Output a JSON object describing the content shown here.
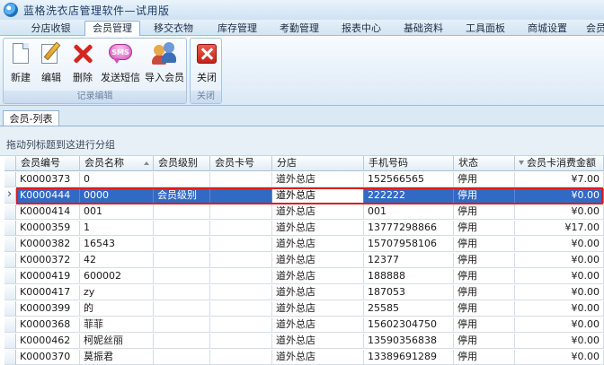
{
  "window": {
    "title": "蓝格洗衣店管理软件—试用版"
  },
  "menu": {
    "tabs": [
      {
        "label": "分店收银",
        "active": false
      },
      {
        "label": "会员管理",
        "active": true
      },
      {
        "label": "移交衣物",
        "active": false
      },
      {
        "label": "库存管理",
        "active": false
      },
      {
        "label": "考勤管理",
        "active": false
      },
      {
        "label": "报表中心",
        "active": false
      },
      {
        "label": "基础资料",
        "active": false
      },
      {
        "label": "工具面板",
        "active": false
      },
      {
        "label": "商城设置",
        "active": false
      },
      {
        "label": "会员",
        "active": false
      }
    ]
  },
  "ribbon": {
    "groups": [
      {
        "label": "记录编辑",
        "buttons": [
          {
            "label": "新建",
            "icon": "new-document-icon"
          },
          {
            "label": "编辑",
            "icon": "edit-pen-icon"
          },
          {
            "label": "删除",
            "icon": "delete-x-icon"
          },
          {
            "label": "发送短信",
            "icon": "sms-bubble-icon"
          },
          {
            "label": "导入会员",
            "icon": "import-members-icon"
          }
        ]
      },
      {
        "label": "关闭",
        "buttons": [
          {
            "label": "关闭",
            "icon": "close-red-icon"
          }
        ]
      }
    ]
  },
  "document_tab": {
    "label": "会员-列表"
  },
  "grid": {
    "group_hint": "拖动列标题到这进行分组",
    "columns": [
      "会员编号",
      "会员名称",
      "会员级别",
      "会员卡号",
      "分店",
      "手机号码",
      "状态",
      "会员卡消费金额"
    ],
    "selected_row": 1,
    "rows": [
      [
        "K0000373",
        "0",
        "",
        "",
        "道外总店",
        "152566565",
        "停用",
        "¥7.00"
      ],
      [
        "K0000444",
        "0000",
        "会员级别",
        "",
        "道外总店",
        "222222",
        "停用",
        "¥0.00"
      ],
      [
        "K0000414",
        "001",
        "",
        "",
        "道外总店",
        "001",
        "停用",
        "¥0.00"
      ],
      [
        "K0000359",
        "1",
        "",
        "",
        "道外总店",
        "13777298866",
        "停用",
        "¥17.00"
      ],
      [
        "K0000382",
        "16543",
        "",
        "",
        "道外总店",
        "15707958106",
        "停用",
        "¥0.00"
      ],
      [
        "K0000372",
        "42",
        "",
        "",
        "道外总店",
        "12377",
        "停用",
        "¥0.00"
      ],
      [
        "K0000419",
        "600002",
        "",
        "",
        "道外总店",
        "188888",
        "停用",
        "¥0.00"
      ],
      [
        "K0000417",
        "zy",
        "",
        "",
        "道外总店",
        "187053",
        "停用",
        "¥0.00"
      ],
      [
        "K0000399",
        "的",
        "",
        "",
        "道外总店",
        "25585",
        "停用",
        "¥0.00"
      ],
      [
        "K0000368",
        "菲菲",
        "",
        "",
        "道外总店",
        "15602304750",
        "停用",
        "¥0.00"
      ],
      [
        "K0000462",
        "柯妮丝丽",
        "",
        "",
        "道外总店",
        "13590356838",
        "停用",
        "¥0.00"
      ],
      [
        "K0000370",
        "莫振君",
        "",
        "",
        "道外总店",
        "13389691289",
        "停用",
        "¥0.00"
      ]
    ]
  },
  "colors": {
    "selection": "#316ac5",
    "highlight_outline": "#e01b1b",
    "accent": "#8eb1d2"
  }
}
